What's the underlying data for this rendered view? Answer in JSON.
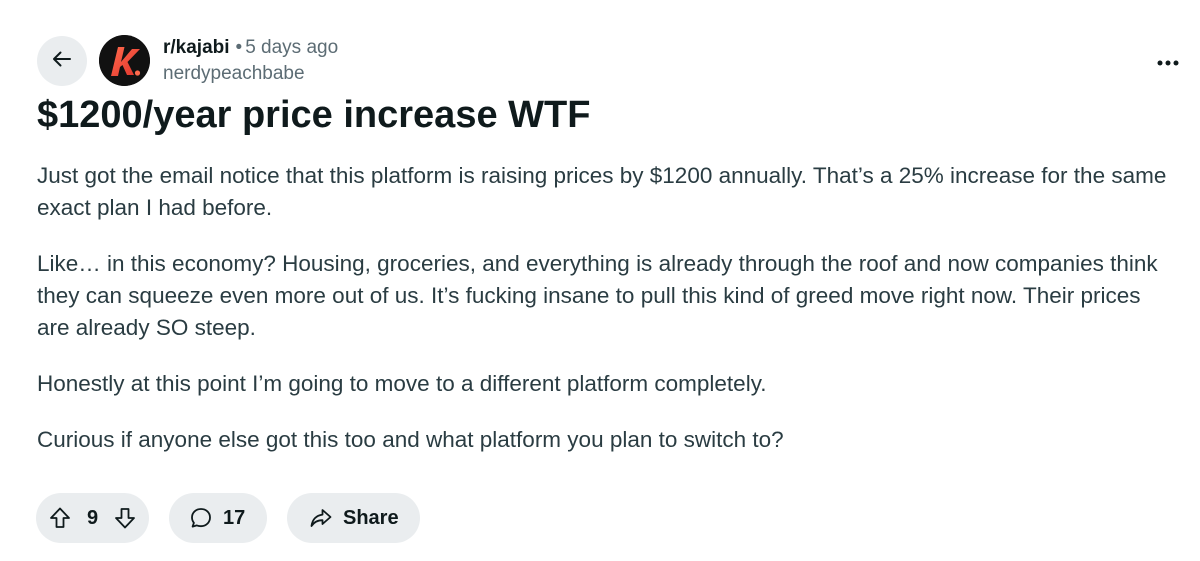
{
  "post": {
    "subreddit": "r/kajabi",
    "separator": "•",
    "time_ago": "5 days ago",
    "author": "nerdypeachbabe",
    "title": "$1200/year price increase WTF",
    "paragraphs": [
      "Just got the email notice that this platform is raising prices by $1200 annually. That’s a 25% increase for the same exact plan I had before.",
      "Like… in this economy? Housing, groceries, and everything is already through the roof and now companies think they can squeeze even more out of us. It’s fucking insane to pull this kind of greed move right now. Their prices are already SO steep.",
      "Honestly at this point I’m going to move to a different platform completely.",
      "Curious if anyone else got this too and what platform you plan to switch to?"
    ]
  },
  "actions": {
    "vote_count": "9",
    "comment_count": "17",
    "share_label": "Share"
  },
  "icons": {
    "back": "arrow-left-icon",
    "avatar": "kajabi-logo",
    "more": "more-horizontal-icon",
    "upvote": "upvote-arrow-icon",
    "downvote": "downvote-arrow-icon",
    "comment": "comment-bubble-icon",
    "share": "share-arrow-icon"
  },
  "colors": {
    "pill_bg": "#eaedef",
    "text_primary": "#0f1a1c",
    "text_secondary": "#5c6c74",
    "avatar_bg": "#111111",
    "avatar_accent": "#f0483e"
  }
}
